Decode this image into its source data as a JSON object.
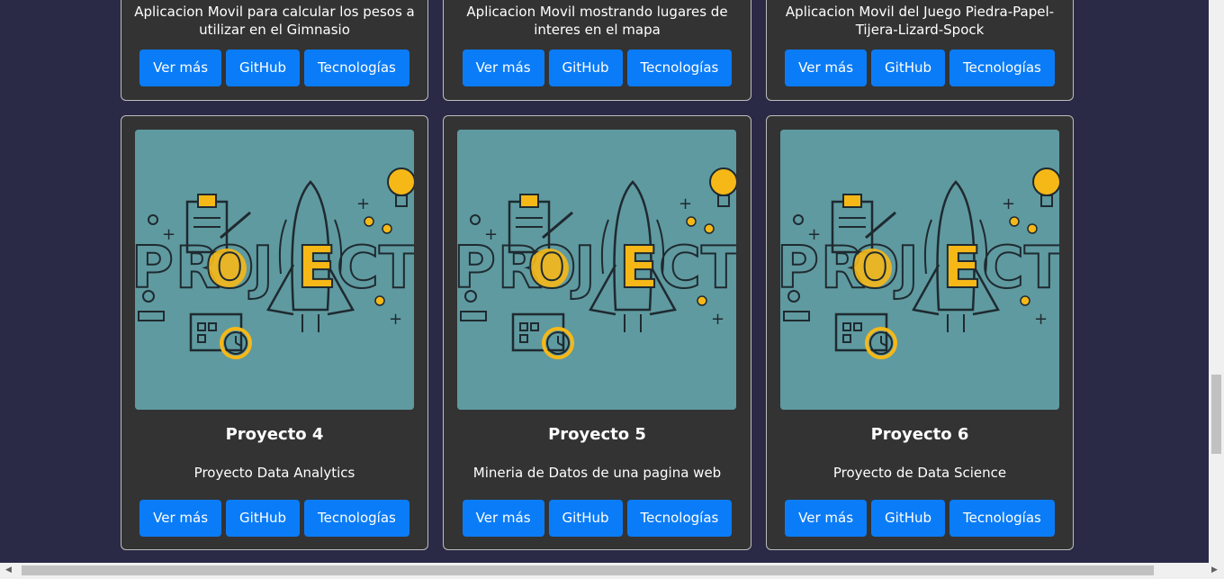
{
  "buttons": {
    "ver_mas": "Ver más",
    "github": "GitHub",
    "tecnologias": "Tecnologías"
  },
  "top_cards": [
    {
      "description": "Aplicacion Movil para calcular los pesos a utilizar en el Gimnasio"
    },
    {
      "description": "Aplicacion Movil mostrando lugares de interes en el mapa"
    },
    {
      "description": "Aplicacion Movil del Juego Piedra-Papel-Tijera-Lizard-Spock"
    }
  ],
  "projects": [
    {
      "title": "Proyecto 4",
      "description": "Proyecto Data Analytics"
    },
    {
      "title": "Proyecto 5",
      "description": "Mineria de Datos de una pagina web"
    },
    {
      "title": "Proyecto 6",
      "description": "Proyecto de Data Science"
    }
  ],
  "image": {
    "word_parts": [
      "PR",
      "O",
      "J",
      "E",
      "CT"
    ],
    "colors": {
      "bg": "#5f9aa0",
      "accent": "#f6b817",
      "line": "#1e2a30"
    }
  },
  "colors": {
    "page_bg": "#2a2946",
    "card_bg": "#333333",
    "button": "#0b7cf7"
  }
}
